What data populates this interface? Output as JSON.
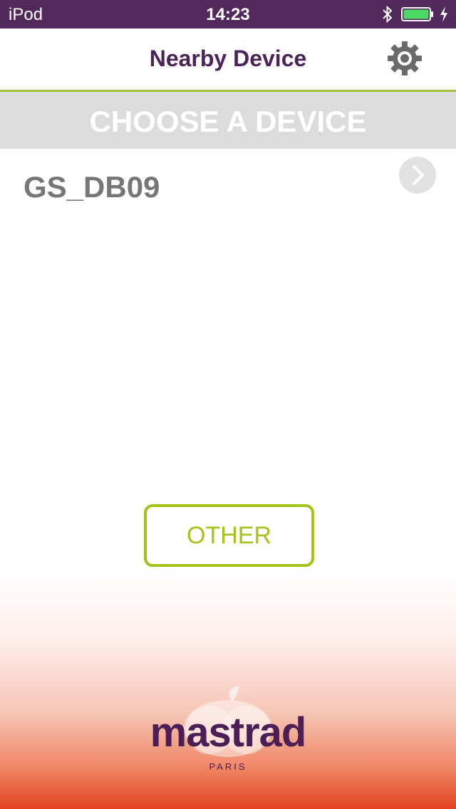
{
  "status_bar": {
    "carrier": "iPod",
    "time": "14:23",
    "bluetooth_icon": "bluetooth-icon",
    "battery_icon": "battery-full-icon",
    "charging_icon": "charging-bolt-icon"
  },
  "nav": {
    "title": "Nearby Device",
    "settings_icon": "gear-icon"
  },
  "section": {
    "title": "CHOOSE A DEVICE"
  },
  "devices": [
    {
      "name": "GS_DB09",
      "chevron_icon": "chevron-right-icon"
    }
  ],
  "other_button": {
    "label": "OTHER"
  },
  "logo": {
    "brand": "mastrad",
    "tagline": "PARIS"
  },
  "colors": {
    "status_bar_bg": "#52295b",
    "title_purple": "#4a2458",
    "accent_green": "#a2c41a",
    "header_gray": "#dcdcdc",
    "device_text_gray": "#777777",
    "gradient_red": "#e4421f"
  }
}
